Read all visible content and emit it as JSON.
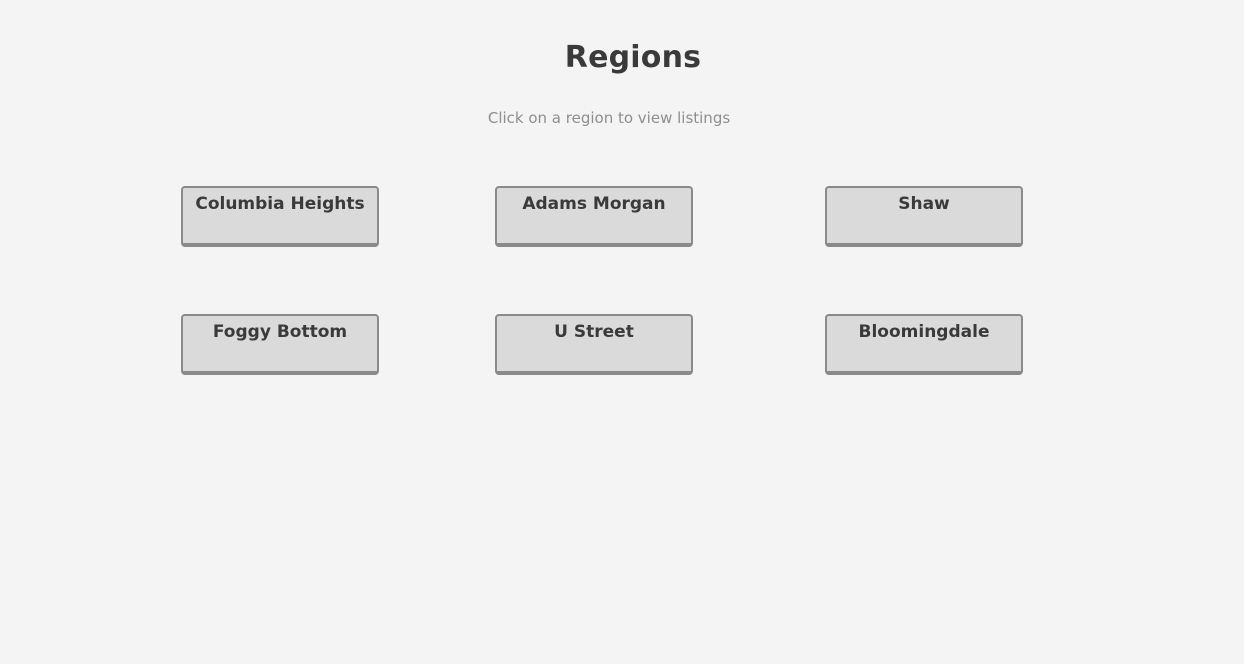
{
  "header": {
    "title": "Regions",
    "subtitle": "Click on a region to view listings"
  },
  "regions": [
    {
      "label": "Columbia Heights"
    },
    {
      "label": "Adams Morgan"
    },
    {
      "label": "Shaw"
    },
    {
      "label": "Foggy Bottom"
    },
    {
      "label": "U Street"
    },
    {
      "label": "Bloomingdale"
    }
  ],
  "colors": {
    "background": "#f4f4f4",
    "button_fill": "#dadada",
    "button_border": "#8a8a8a",
    "title_text": "#3a3a3a",
    "subtitle_text": "#8e8e8e"
  }
}
